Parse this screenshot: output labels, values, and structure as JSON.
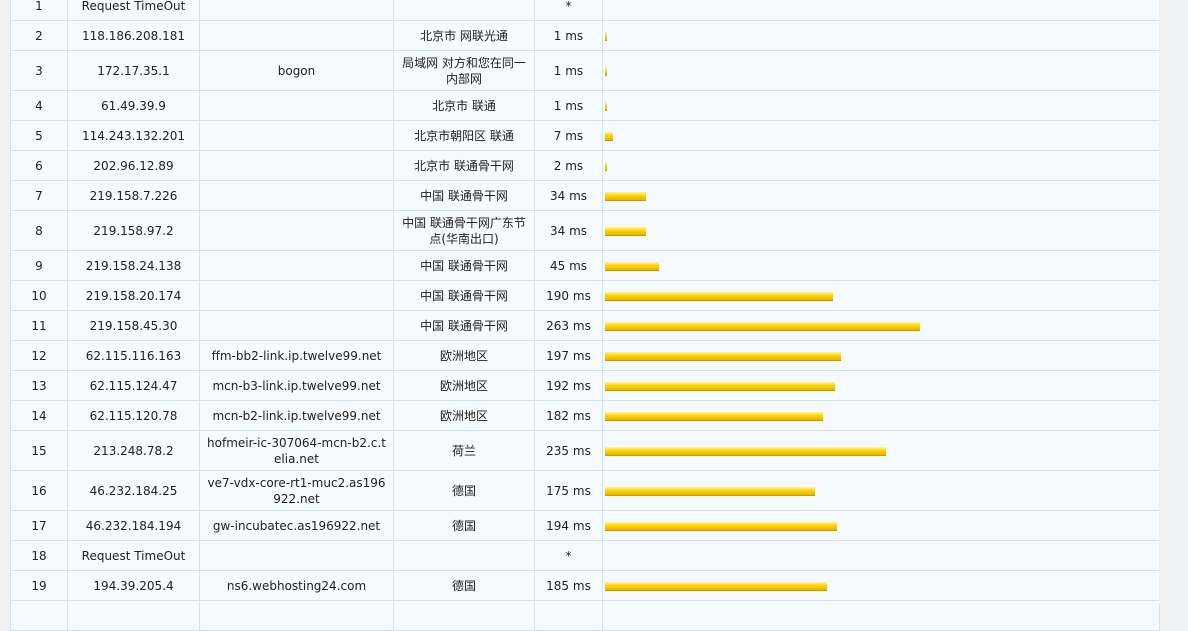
{
  "bar_color": "#ffd400",
  "max_ms": 263,
  "hops": [
    {
      "hop": "1",
      "ip": "Request TimeOut",
      "host": "",
      "location": "",
      "time": "*",
      "ms": null
    },
    {
      "hop": "2",
      "ip": "118.186.208.181",
      "host": "",
      "location": "北京市 网联光通",
      "time": "1 ms",
      "ms": 1
    },
    {
      "hop": "3",
      "ip": "172.17.35.1",
      "host": "bogon",
      "location": "局域网 对方和您在同一内部网",
      "time": "1 ms",
      "ms": 1
    },
    {
      "hop": "4",
      "ip": "61.49.39.9",
      "host": "",
      "location": "北京市 联通",
      "time": "1 ms",
      "ms": 1
    },
    {
      "hop": "5",
      "ip": "114.243.132.201",
      "host": "",
      "location": "北京市朝阳区 联通",
      "time": "7 ms",
      "ms": 7
    },
    {
      "hop": "6",
      "ip": "202.96.12.89",
      "host": "",
      "location": "北京市 联通骨干网",
      "time": "2 ms",
      "ms": 2
    },
    {
      "hop": "7",
      "ip": "219.158.7.226",
      "host": "",
      "location": "中国 联通骨干网",
      "time": "34 ms",
      "ms": 34
    },
    {
      "hop": "8",
      "ip": "219.158.97.2",
      "host": "",
      "location": "中国 联通骨干网广东节点(华南出口)",
      "time": "34 ms",
      "ms": 34
    },
    {
      "hop": "9",
      "ip": "219.158.24.138",
      "host": "",
      "location": "中国 联通骨干网",
      "time": "45 ms",
      "ms": 45
    },
    {
      "hop": "10",
      "ip": "219.158.20.174",
      "host": "",
      "location": "中国 联通骨干网",
      "time": "190 ms",
      "ms": 190
    },
    {
      "hop": "11",
      "ip": "219.158.45.30",
      "host": "",
      "location": "中国 联通骨干网",
      "time": "263 ms",
      "ms": 263
    },
    {
      "hop": "12",
      "ip": "62.115.116.163",
      "host": "ffm-bb2-link.ip.twelve99.net",
      "location": "欧洲地区",
      "time": "197 ms",
      "ms": 197
    },
    {
      "hop": "13",
      "ip": "62.115.124.47",
      "host": "mcn-b3-link.ip.twelve99.net",
      "location": "欧洲地区",
      "time": "192 ms",
      "ms": 192
    },
    {
      "hop": "14",
      "ip": "62.115.120.78",
      "host": "mcn-b2-link.ip.twelve99.net",
      "location": "欧洲地区",
      "time": "182 ms",
      "ms": 182
    },
    {
      "hop": "15",
      "ip": "213.248.78.2",
      "host": "hofmeir-ic-307064-mcn-b2.c.telia.net",
      "location": "荷兰",
      "time": "235 ms",
      "ms": 235
    },
    {
      "hop": "16",
      "ip": "46.232.184.25",
      "host": "ve7-vdx-core-rt1-muc2.as196922.net",
      "location": "德国",
      "time": "175 ms",
      "ms": 175
    },
    {
      "hop": "17",
      "ip": "46.232.184.194",
      "host": "gw-incubatec.as196922.net",
      "location": "德国",
      "time": "194 ms",
      "ms": 194
    },
    {
      "hop": "18",
      "ip": "Request TimeOut",
      "host": "",
      "location": "",
      "time": "*",
      "ms": null
    },
    {
      "hop": "19",
      "ip": "194.39.205.4",
      "host": "ns6.webhosting24.com",
      "location": "德国",
      "time": "185 ms",
      "ms": 185
    },
    {
      "hop": "",
      "ip": "",
      "host": "",
      "location": "",
      "time": "",
      "ms": null
    }
  ]
}
